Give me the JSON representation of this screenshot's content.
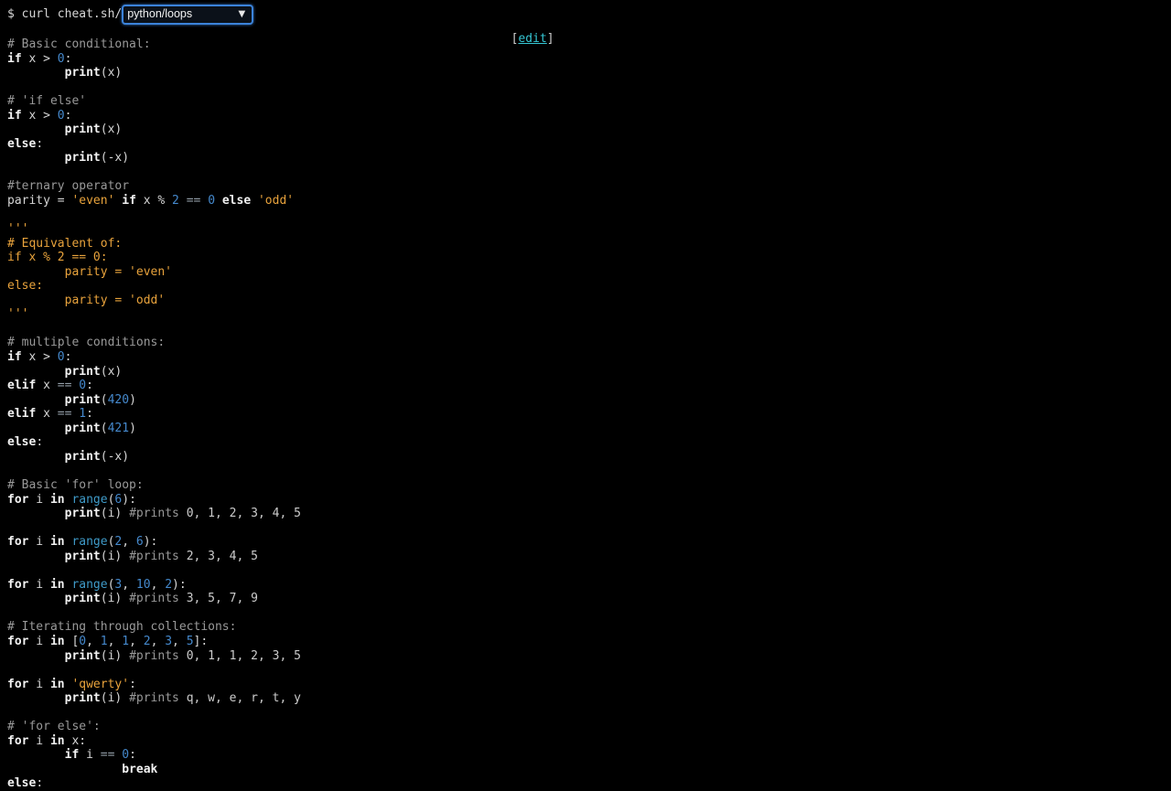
{
  "terminal": {
    "prompt": "$ curl cheat.sh/",
    "topic_select": {
      "value": "python/loops",
      "arrow_icon": "▼"
    },
    "edit": {
      "open": "[",
      "label": "edit",
      "close": "]"
    }
  },
  "colors": {
    "bg": "#000000",
    "txt": "#d6d6d6",
    "kw": "#f2f2f2",
    "com": "#999999",
    "val": "#cccccc",
    "num": "#4589cd",
    "bi": "#3f9bc9",
    "str": "#e9a33c",
    "op": "#95a0aa",
    "link": "#35c7d4",
    "sel_border": "#3b82d9"
  },
  "code": {
    "lines": [
      [
        [
          "com",
          "# Basic conditional:"
        ]
      ],
      [
        [
          "kw",
          "if"
        ],
        [
          "txt",
          " x > "
        ],
        [
          "num",
          "0"
        ],
        [
          "txt",
          ":"
        ]
      ],
      [
        [
          "txt",
          "        "
        ],
        [
          "kw",
          "print"
        ],
        [
          "txt",
          "(x)"
        ]
      ],
      [],
      [
        [
          "com",
          "# 'if else'"
        ]
      ],
      [
        [
          "kw",
          "if"
        ],
        [
          "txt",
          " x > "
        ],
        [
          "num",
          "0"
        ],
        [
          "txt",
          ":"
        ]
      ],
      [
        [
          "txt",
          "        "
        ],
        [
          "kw",
          "print"
        ],
        [
          "txt",
          "(x)"
        ]
      ],
      [
        [
          "kw",
          "else"
        ],
        [
          "txt",
          ":"
        ]
      ],
      [
        [
          "txt",
          "        "
        ],
        [
          "kw",
          "print"
        ],
        [
          "txt",
          "(-x)"
        ]
      ],
      [],
      [
        [
          "com",
          "#ternary operator"
        ]
      ],
      [
        [
          "txt",
          "parity = "
        ],
        [
          "str",
          "'even'"
        ],
        [
          "txt",
          " "
        ],
        [
          "kw",
          "if"
        ],
        [
          "txt",
          " x % "
        ],
        [
          "num",
          "2"
        ],
        [
          "txt",
          " "
        ],
        [
          "op",
          "=="
        ],
        [
          "txt",
          " "
        ],
        [
          "num",
          "0"
        ],
        [
          "txt",
          " "
        ],
        [
          "kw",
          "else"
        ],
        [
          "txt",
          " "
        ],
        [
          "str",
          "'odd'"
        ]
      ],
      [],
      [
        [
          "str",
          "'''"
        ]
      ],
      [
        [
          "str",
          "# Equivalent of:"
        ]
      ],
      [
        [
          "str",
          "if x % 2 == 0:"
        ]
      ],
      [
        [
          "str",
          "        parity = 'even'"
        ]
      ],
      [
        [
          "str",
          "else:"
        ]
      ],
      [
        [
          "str",
          "        parity = 'odd'"
        ]
      ],
      [
        [
          "str",
          "'''"
        ]
      ],
      [],
      [
        [
          "com",
          "# multiple conditions:"
        ]
      ],
      [
        [
          "kw",
          "if"
        ],
        [
          "txt",
          " x > "
        ],
        [
          "num",
          "0"
        ],
        [
          "txt",
          ":"
        ]
      ],
      [
        [
          "txt",
          "        "
        ],
        [
          "kw",
          "print"
        ],
        [
          "txt",
          "(x)"
        ]
      ],
      [
        [
          "kw",
          "elif"
        ],
        [
          "txt",
          " x "
        ],
        [
          "op",
          "=="
        ],
        [
          "txt",
          " "
        ],
        [
          "num",
          "0"
        ],
        [
          "txt",
          ":"
        ]
      ],
      [
        [
          "txt",
          "        "
        ],
        [
          "kw",
          "print"
        ],
        [
          "txt",
          "("
        ],
        [
          "num",
          "420"
        ],
        [
          "txt",
          ")"
        ]
      ],
      [
        [
          "kw",
          "elif"
        ],
        [
          "txt",
          " x "
        ],
        [
          "op",
          "=="
        ],
        [
          "txt",
          " "
        ],
        [
          "num",
          "1"
        ],
        [
          "txt",
          ":"
        ]
      ],
      [
        [
          "txt",
          "        "
        ],
        [
          "kw",
          "print"
        ],
        [
          "txt",
          "("
        ],
        [
          "num",
          "421"
        ],
        [
          "txt",
          ")"
        ]
      ],
      [
        [
          "kw",
          "else"
        ],
        [
          "txt",
          ":"
        ]
      ],
      [
        [
          "txt",
          "        "
        ],
        [
          "kw",
          "print"
        ],
        [
          "txt",
          "(-x)"
        ]
      ],
      [],
      [
        [
          "com",
          "# Basic 'for' loop:"
        ]
      ],
      [
        [
          "kw",
          "for"
        ],
        [
          "txt",
          " i "
        ],
        [
          "kw",
          "in"
        ],
        [
          "txt",
          " "
        ],
        [
          "bi",
          "range"
        ],
        [
          "txt",
          "("
        ],
        [
          "num",
          "6"
        ],
        [
          "txt",
          "):"
        ]
      ],
      [
        [
          "txt",
          "        "
        ],
        [
          "kw",
          "print"
        ],
        [
          "txt",
          "(i) "
        ],
        [
          "com",
          "#prints "
        ],
        [
          "val",
          "0, 1, 2, 3, 4, 5"
        ]
      ],
      [],
      [
        [
          "kw",
          "for"
        ],
        [
          "txt",
          " i "
        ],
        [
          "kw",
          "in"
        ],
        [
          "txt",
          " "
        ],
        [
          "bi",
          "range"
        ],
        [
          "txt",
          "("
        ],
        [
          "num",
          "2"
        ],
        [
          "txt",
          ", "
        ],
        [
          "num",
          "6"
        ],
        [
          "txt",
          "):"
        ]
      ],
      [
        [
          "txt",
          "        "
        ],
        [
          "kw",
          "print"
        ],
        [
          "txt",
          "(i) "
        ],
        [
          "com",
          "#prints "
        ],
        [
          "val",
          "2, 3, 4, 5"
        ]
      ],
      [],
      [
        [
          "kw",
          "for"
        ],
        [
          "txt",
          " i "
        ],
        [
          "kw",
          "in"
        ],
        [
          "txt",
          " "
        ],
        [
          "bi",
          "range"
        ],
        [
          "txt",
          "("
        ],
        [
          "num",
          "3"
        ],
        [
          "txt",
          ", "
        ],
        [
          "num",
          "10"
        ],
        [
          "txt",
          ", "
        ],
        [
          "num",
          "2"
        ],
        [
          "txt",
          "):"
        ]
      ],
      [
        [
          "txt",
          "        "
        ],
        [
          "kw",
          "print"
        ],
        [
          "txt",
          "(i) "
        ],
        [
          "com",
          "#prints "
        ],
        [
          "val",
          "3, 5, 7, 9"
        ]
      ],
      [],
      [
        [
          "com",
          "# Iterating through collections:"
        ]
      ],
      [
        [
          "kw",
          "for"
        ],
        [
          "txt",
          " i "
        ],
        [
          "kw",
          "in"
        ],
        [
          "txt",
          " ["
        ],
        [
          "num",
          "0"
        ],
        [
          "txt",
          ", "
        ],
        [
          "num",
          "1"
        ],
        [
          "txt",
          ", "
        ],
        [
          "num",
          "1"
        ],
        [
          "txt",
          ", "
        ],
        [
          "num",
          "2"
        ],
        [
          "txt",
          ", "
        ],
        [
          "num",
          "3"
        ],
        [
          "txt",
          ", "
        ],
        [
          "num",
          "5"
        ],
        [
          "txt",
          "]:"
        ]
      ],
      [
        [
          "txt",
          "        "
        ],
        [
          "kw",
          "print"
        ],
        [
          "txt",
          "(i) "
        ],
        [
          "com",
          "#prints "
        ],
        [
          "val",
          "0, 1, 1, 2, 3, 5"
        ]
      ],
      [],
      [
        [
          "kw",
          "for"
        ],
        [
          "txt",
          " i "
        ],
        [
          "kw",
          "in"
        ],
        [
          "txt",
          " "
        ],
        [
          "str",
          "'qwerty'"
        ],
        [
          "txt",
          ":"
        ]
      ],
      [
        [
          "txt",
          "        "
        ],
        [
          "kw",
          "print"
        ],
        [
          "txt",
          "(i) "
        ],
        [
          "com",
          "#prints "
        ],
        [
          "val",
          "q, w, e, r, t, y"
        ]
      ],
      [],
      [
        [
          "com",
          "# 'for else':"
        ]
      ],
      [
        [
          "kw",
          "for"
        ],
        [
          "txt",
          " i "
        ],
        [
          "kw",
          "in"
        ],
        [
          "txt",
          " x:"
        ]
      ],
      [
        [
          "txt",
          "        "
        ],
        [
          "kw",
          "if"
        ],
        [
          "txt",
          " i "
        ],
        [
          "op",
          "=="
        ],
        [
          "txt",
          " "
        ],
        [
          "num",
          "0"
        ],
        [
          "txt",
          ":"
        ]
      ],
      [
        [
          "txt",
          "                "
        ],
        [
          "kw",
          "break"
        ]
      ],
      [
        [
          "kw",
          "else"
        ],
        [
          "txt",
          ":"
        ]
      ]
    ]
  }
}
